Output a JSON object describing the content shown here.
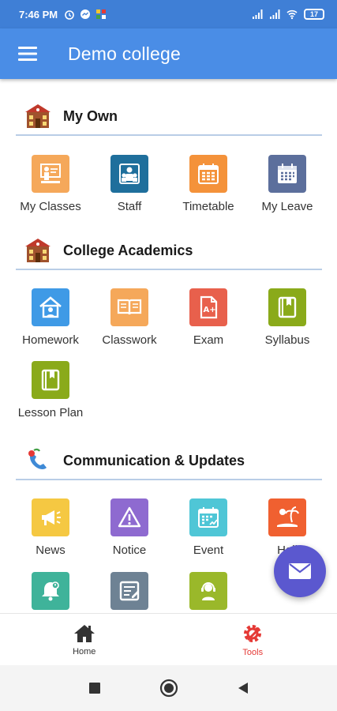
{
  "status": {
    "time": "7:46 PM",
    "battery": "17"
  },
  "appbar": {
    "title": "Demo college"
  },
  "sections": {
    "my_own": {
      "title": "My Own",
      "items": [
        {
          "label": "My Classes",
          "icon": "classroom-icon",
          "color": "#f5a85a"
        },
        {
          "label": "Staff",
          "icon": "staff-icon",
          "color": "#1f6f9c"
        },
        {
          "label": "Timetable",
          "icon": "timetable-icon",
          "color": "#f4923a"
        },
        {
          "label": "My Leave",
          "icon": "calendar-icon",
          "color": "#5c6f9c"
        }
      ]
    },
    "college_academics": {
      "title": "College Academics",
      "items": [
        {
          "label": "Homework",
          "icon": "homework-icon",
          "color": "#3f9ae6"
        },
        {
          "label": "Classwork",
          "icon": "book-open-icon",
          "color": "#f5a85a"
        },
        {
          "label": "Exam",
          "icon": "exam-icon",
          "color": "#e8604c"
        },
        {
          "label": "Syllabus",
          "icon": "syllabus-icon",
          "color": "#8aaa1a"
        },
        {
          "label": "Lesson Plan",
          "icon": "lesson-plan-icon",
          "color": "#8aaa1a"
        }
      ]
    },
    "communication": {
      "title": "Communication & Updates",
      "items": [
        {
          "label": "News",
          "icon": "megaphone-icon",
          "color": "#f5c842"
        },
        {
          "label": "Notice",
          "icon": "warning-icon",
          "color": "#8e6ad0"
        },
        {
          "label": "Event",
          "icon": "event-icon",
          "color": "#4fc6d6"
        },
        {
          "label": "Holi",
          "icon": "holiday-icon",
          "color": "#f06030"
        },
        {
          "label": "",
          "icon": "reminder-icon",
          "color": "#3fb39a"
        },
        {
          "label": "",
          "icon": "notes-icon",
          "color": "#6e8294"
        },
        {
          "label": "",
          "icon": "support-icon",
          "color": "#9ab82a"
        }
      ]
    }
  },
  "bottom_nav": {
    "home": {
      "label": "Home",
      "color": "#333333"
    },
    "tools": {
      "label": "Tools",
      "color": "#e53935"
    }
  },
  "colors": {
    "primary": "#4a8de6",
    "fab": "#5b58cf",
    "accent": "#e53935"
  }
}
